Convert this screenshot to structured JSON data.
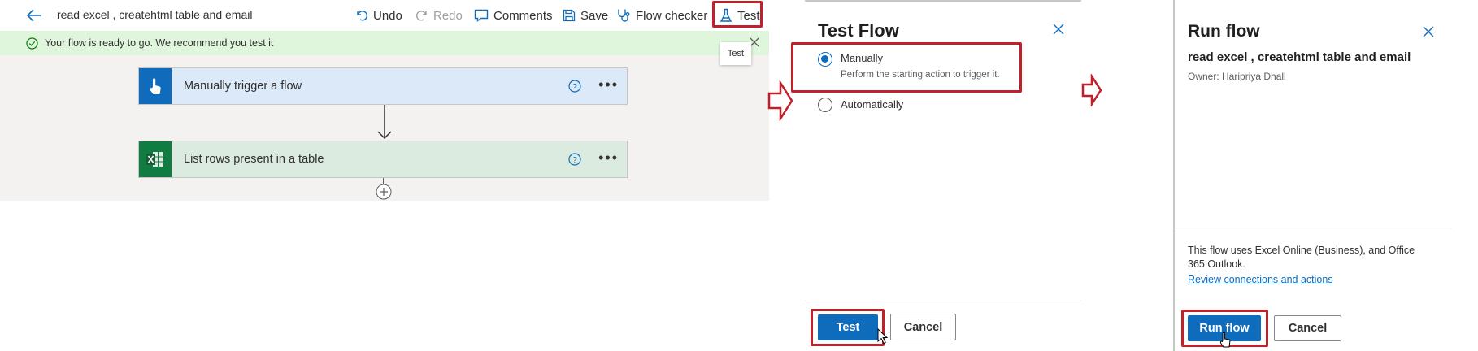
{
  "editor": {
    "flow_title": "read excel , createhtml table and email",
    "toolbar": {
      "undo": "Undo",
      "redo": "Redo",
      "comments": "Comments",
      "save": "Save",
      "flow_checker": "Flow checker",
      "test": "Test"
    },
    "tooltip": "Test",
    "banner": "Your flow is ready to go. We recommend you test it",
    "steps": [
      {
        "label": "Manually trigger a flow",
        "icon": "touch-icon"
      },
      {
        "label": "List rows present in a table",
        "icon": "excel-icon"
      }
    ]
  },
  "test_flow": {
    "title": "Test Flow",
    "options": [
      {
        "label": "Manually",
        "description": "Perform the starting action to trigger it.",
        "selected": true
      },
      {
        "label": "Automatically",
        "description": "",
        "selected": false
      }
    ],
    "test_button": "Test",
    "cancel_button": "Cancel"
  },
  "run_flow": {
    "title": "Run flow",
    "flow_name": "read excel , createhtml table and email",
    "owner": "Owner: Haripriya Dhall",
    "connections_text": "This flow uses Excel Online (Business), and Office 365 Outlook.",
    "review_link": "Review connections and actions",
    "run_button": "Run flow",
    "cancel_button": "Cancel"
  },
  "colors": {
    "accent": "#0f6cbd",
    "highlight_border": "#c0202a",
    "banner_bg": "#dff6dd",
    "trigger_card": "#dbe9f8",
    "action_card": "#dcebe0"
  }
}
